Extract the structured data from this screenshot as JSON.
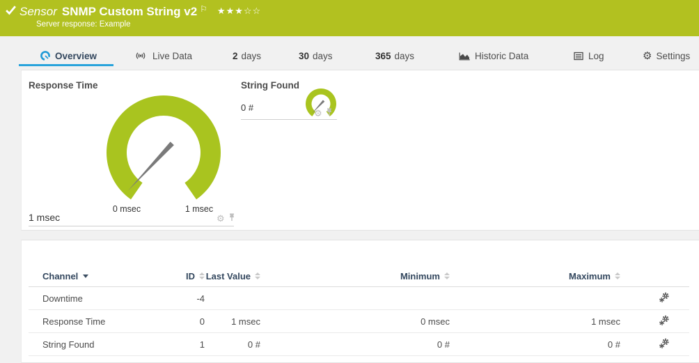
{
  "colors": {
    "brand_green": "#b2c120",
    "gauge_green": "#a9c41f",
    "accent_blue": "#29a3db",
    "needle_gray": "#7a7a7a",
    "header_text": "#33475e"
  },
  "sensor_header": {
    "status_icon": "check-ok",
    "type_label": "Sensor",
    "title": "SNMP Custom String v2",
    "subtitle": "Server response: Example",
    "stars": "★★★☆☆",
    "flag": "⚐"
  },
  "tabs": [
    {
      "bold": "",
      "label": "Overview",
      "active": true
    },
    {
      "bold": "",
      "label": "Live Data",
      "active": false
    },
    {
      "bold": "2",
      "label": "days",
      "active": false
    },
    {
      "bold": "30",
      "label": "days",
      "active": false
    },
    {
      "bold": "365",
      "label": "days",
      "active": false
    },
    {
      "bold": "",
      "label": "Historic Data",
      "active": false
    },
    {
      "bold": "",
      "label": "Log",
      "active": false
    },
    {
      "bold": "",
      "label": "Settings",
      "active": false
    }
  ],
  "gauges": [
    {
      "title": "Response Time",
      "value": "1 msec",
      "min_label": "0 msec",
      "max_label": "1 msec"
    },
    {
      "title": "String Found",
      "value": "0 #"
    }
  ],
  "table": {
    "headers": [
      "Channel",
      "ID",
      "Last Value",
      "Minimum",
      "Maximum"
    ],
    "rows": [
      {
        "channel": "Downtime",
        "id": "-4",
        "last": "",
        "min": "",
        "max": ""
      },
      {
        "channel": "Response Time",
        "id": "0",
        "last": "1 msec",
        "min": "0 msec",
        "max": "1 msec"
      },
      {
        "channel": "String Found",
        "id": "1",
        "last": "0 #",
        "min": "0 #",
        "max": "0 #"
      }
    ]
  },
  "gear_glyph": "⚙"
}
